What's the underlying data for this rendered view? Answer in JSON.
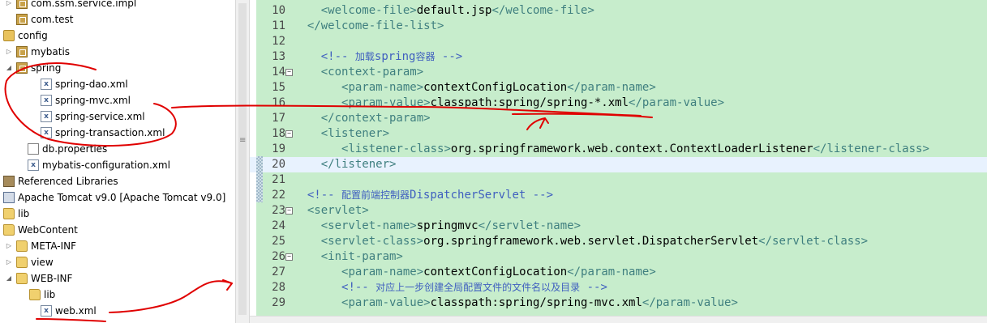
{
  "explorer": {
    "items": [
      {
        "label": "com.ssm.service.impl",
        "icon": "package-icon"
      },
      {
        "label": "com.test",
        "icon": "package-icon"
      },
      {
        "label": "config",
        "icon": "source-folder-icon"
      },
      {
        "label": "mybatis",
        "icon": "package-icon"
      },
      {
        "label": "spring",
        "icon": "package-icon"
      },
      {
        "label": "spring-dao.xml",
        "icon": "xml-file-icon"
      },
      {
        "label": "spring-mvc.xml",
        "icon": "xml-file-icon"
      },
      {
        "label": "spring-service.xml",
        "icon": "xml-file-icon"
      },
      {
        "label": "spring-transaction.xml",
        "icon": "xml-file-icon"
      },
      {
        "label": "db.properties",
        "icon": "properties-file-icon"
      },
      {
        "label": "mybatis-configuration.xml",
        "icon": "xml-file-icon"
      },
      {
        "label": "Referenced Libraries",
        "icon": "library-icon"
      },
      {
        "label": "Apache Tomcat v9.0 [Apache Tomcat v9.0]",
        "icon": "server-runtime-icon"
      },
      {
        "label": "lib",
        "icon": "folder-icon"
      },
      {
        "label": "WebContent",
        "icon": "folder-icon"
      },
      {
        "label": "META-INF",
        "icon": "folder-icon"
      },
      {
        "label": "view",
        "icon": "folder-icon"
      },
      {
        "label": "WEB-INF",
        "icon": "folder-icon"
      },
      {
        "label": "lib",
        "icon": "folder-icon"
      },
      {
        "label": "web.xml",
        "icon": "xml-file-icon"
      }
    ]
  },
  "editor": {
    "lines": [
      {
        "n": "10",
        "t1": "    ",
        "tag1": "<welcome-file>",
        "text": "default.jsp",
        "tag2": "</welcome-file>"
      },
      {
        "n": "11",
        "t1": "  ",
        "tag1": "</welcome-file-list>"
      },
      {
        "n": "12"
      },
      {
        "n": "13",
        "t1": "    ",
        "comment_a": "<!-- ",
        "comment_cjk": "加载",
        "comment_b": "spring",
        "comment_cjk2": "容器",
        "comment_c": " -->"
      },
      {
        "n": "14",
        "t1": "    ",
        "tag1": "<context-param>"
      },
      {
        "n": "15",
        "t1": "       ",
        "tag1": "<param-name>",
        "text": "contextConfigLocation",
        "tag2": "</param-name>"
      },
      {
        "n": "16",
        "t1": "       ",
        "tag1": "<param-value>",
        "text": "classpath:spring/spring-*.xml",
        "tag2": "</param-value>"
      },
      {
        "n": "17",
        "t1": "    ",
        "tag1": "</context-param>"
      },
      {
        "n": "18",
        "t1": "    ",
        "tag1": "<listener>"
      },
      {
        "n": "19",
        "t1": "       ",
        "tag1": "<listener-class>",
        "text": "org.springframework.web.context.ContextLoaderListener",
        "tag2": "</listener-class>"
      },
      {
        "n": "20",
        "t1": "    ",
        "tag1": "</listener>"
      },
      {
        "n": "21"
      },
      {
        "n": "22",
        "t1": "  ",
        "comment_a": "<!-- ",
        "comment_cjk": "配置前端控制器",
        "comment_b": "DispatcherServlet",
        "comment_c": " -->"
      },
      {
        "n": "23",
        "t1": "  ",
        "tag1": "<servlet>"
      },
      {
        "n": "24",
        "t1": "    ",
        "tag1": "<servlet-name>",
        "text": "springmvc",
        "tag2": "</servlet-name>"
      },
      {
        "n": "25",
        "t1": "    ",
        "tag1": "<servlet-class>",
        "text": "org.springframework.web.servlet.DispatcherServlet",
        "tag2": "</servlet-class>"
      },
      {
        "n": "26",
        "t1": "    ",
        "tag1": "<init-param>"
      },
      {
        "n": "27",
        "t1": "       ",
        "tag1": "<param-name>",
        "text": "contextConfigLocation",
        "tag2": "</param-name>"
      },
      {
        "n": "28",
        "t1": "       ",
        "comment_a": "<!-- ",
        "comment_cjk": "对应上一步创建全局配置文件的文件名以及目录",
        "comment_c": " -->"
      },
      {
        "n": "29",
        "t1": "       ",
        "tag1": "<param-value>",
        "text": "classpath:spring/spring-mvc.xml",
        "tag2": "</param-value>"
      }
    ]
  },
  "colors": {
    "editor_background": "#c7edcc",
    "tag": "#3f7f7f",
    "comment": "#3f5fbf",
    "annotation": "#e00000"
  }
}
